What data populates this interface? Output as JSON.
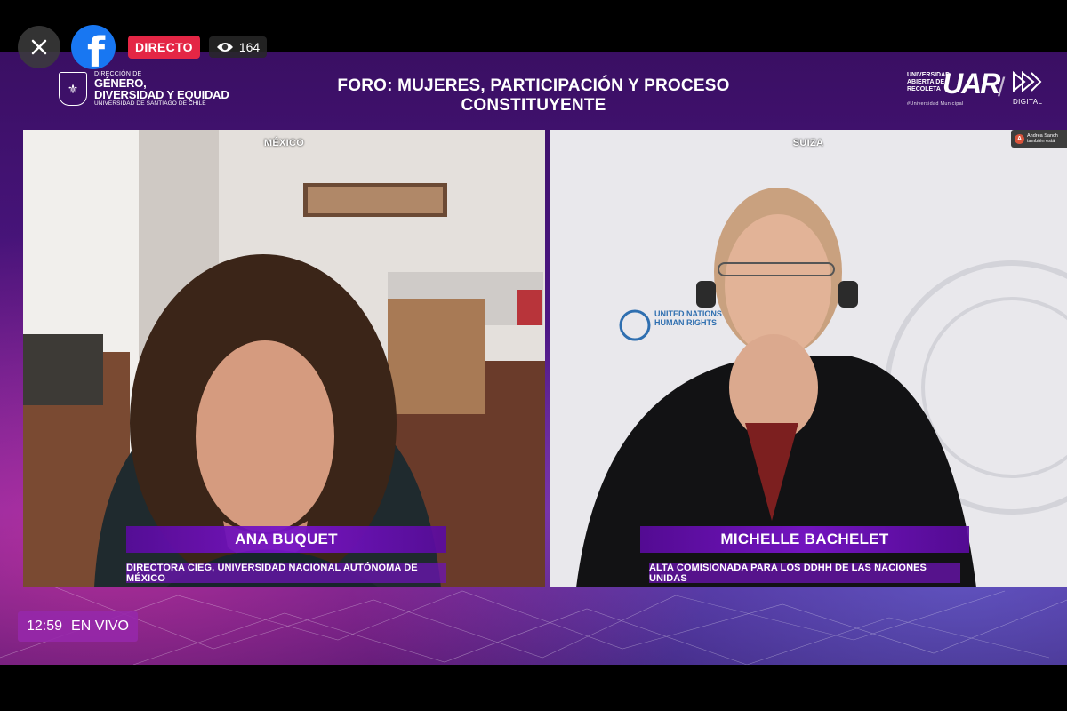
{
  "facebook": {
    "close_icon": "close-icon",
    "logo_icon": "facebook-logo-icon",
    "live_label": "DIRECTO",
    "viewer_count": "164",
    "viewer_icon": "eye-icon"
  },
  "header": {
    "title": "FORO: MUJERES, PARTICIPACIÓN Y PROCESO CONSTITUYENTE",
    "left_logo": {
      "line1": "DIRECCIÓN DE",
      "line2": "GÉNERO,",
      "line3": "DIVERSIDAD Y EQUIDAD",
      "line4": "UNIVERSIDAD DE SANTIAGO DE CHILE"
    },
    "right_logo": {
      "line1": "UNIVERSIDAD",
      "line2": "ABIERTA DE",
      "line3": "RECOLETA",
      "mark": "UAR",
      "footer": "#Universidad Municipal",
      "digital": "DIGITAL"
    }
  },
  "panels": [
    {
      "country": "MÉXICO",
      "name": "ANA BUQUET",
      "role": "DIRECTORA CIEG, UNIVERSIDAD NACIONAL AUTÓNOMA DE MÉXICO"
    },
    {
      "country": "SUIZA",
      "name": "MICHELLE BACHELET",
      "role": "ALTA COMISIONADA PARA LOS DDHH DE LAS NACIONES UNIDAS",
      "backdrop_text": "UNITED NATIONS HUMAN RIGHTS"
    }
  ],
  "notification": {
    "avatar_letter": "A",
    "line1": "Andrea Sanch",
    "line2": "también está"
  },
  "clock": {
    "time": "12:59",
    "label": "EN VIVO"
  },
  "colors": {
    "live_red": "#e42645",
    "facebook_blue": "#1877f2",
    "banner_purple": "#7814c8"
  }
}
